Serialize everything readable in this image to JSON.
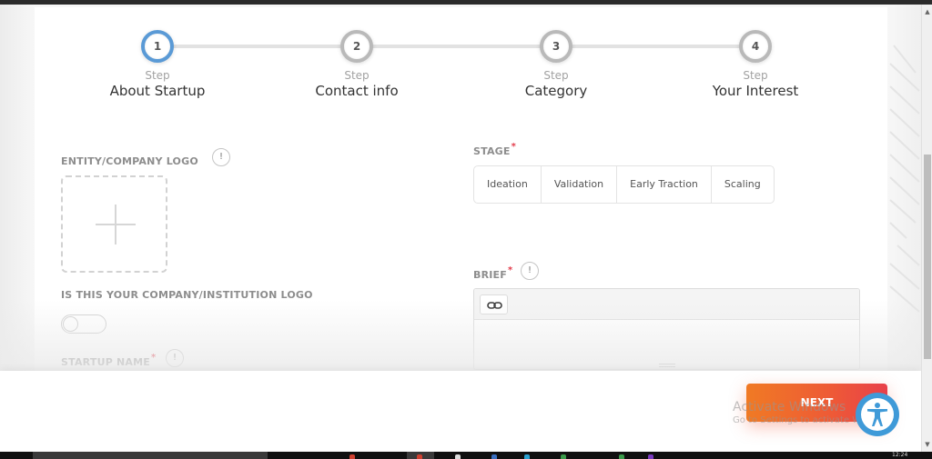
{
  "stepper": {
    "steps": [
      {
        "number": "1",
        "caption": "Step",
        "title": "About Startup",
        "state": "active"
      },
      {
        "number": "2",
        "caption": "Step",
        "title": "Contact info",
        "state": "inactive"
      },
      {
        "number": "3",
        "caption": "Step",
        "title": "Category",
        "state": "inactive"
      },
      {
        "number": "4",
        "caption": "Step",
        "title": "Your Interest",
        "state": "inactive"
      }
    ]
  },
  "form": {
    "logo": {
      "label": "ENTITY/COMPANY LOGO",
      "info_icon": "!"
    },
    "own_logo": {
      "label": "IS THIS YOUR COMPANY/INSTITUTION LOGO",
      "toggle_on": false
    },
    "startup_name": {
      "label": "STARTUP NAME",
      "required_mark": "*",
      "info_icon": "!"
    },
    "stage": {
      "label": "STAGE",
      "required_mark": "*",
      "options": [
        "Ideation",
        "Validation",
        "Early Traction",
        "Scaling"
      ]
    },
    "brief": {
      "label": "BRIEF",
      "required_mark": "*",
      "info_icon": "!",
      "value": ""
    }
  },
  "footer": {
    "next_label": "NEXT"
  },
  "watermark": {
    "line1": "Activate Windows",
    "line2": "Go to Settings to activate Windows."
  },
  "taskbar": {
    "clock": "12:24"
  },
  "colors": {
    "accent_active_step": "#5a9ad6",
    "next_gradient_start": "#f07a24",
    "next_gradient_end": "#e8404a",
    "required": "#e33d4c",
    "accessibility": "#3f9ad8"
  }
}
